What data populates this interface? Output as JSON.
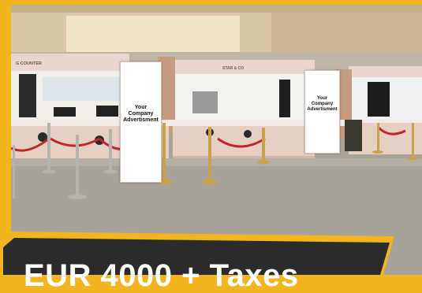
{
  "advertisements": [
    {
      "text": "Your\nCompany\nAdvertisment"
    },
    {
      "text": "Your\nCompany\nAdvertisment"
    }
  ],
  "counter_signs": [
    "G COUNTER",
    "STAR & CO"
  ],
  "price_banner": {
    "text": "EUR 4000 + Taxes"
  },
  "colors": {
    "frame": "#f2b51e",
    "banner": "#2b2b2b",
    "rope": "#c0262b",
    "post": "#c9a24a"
  }
}
